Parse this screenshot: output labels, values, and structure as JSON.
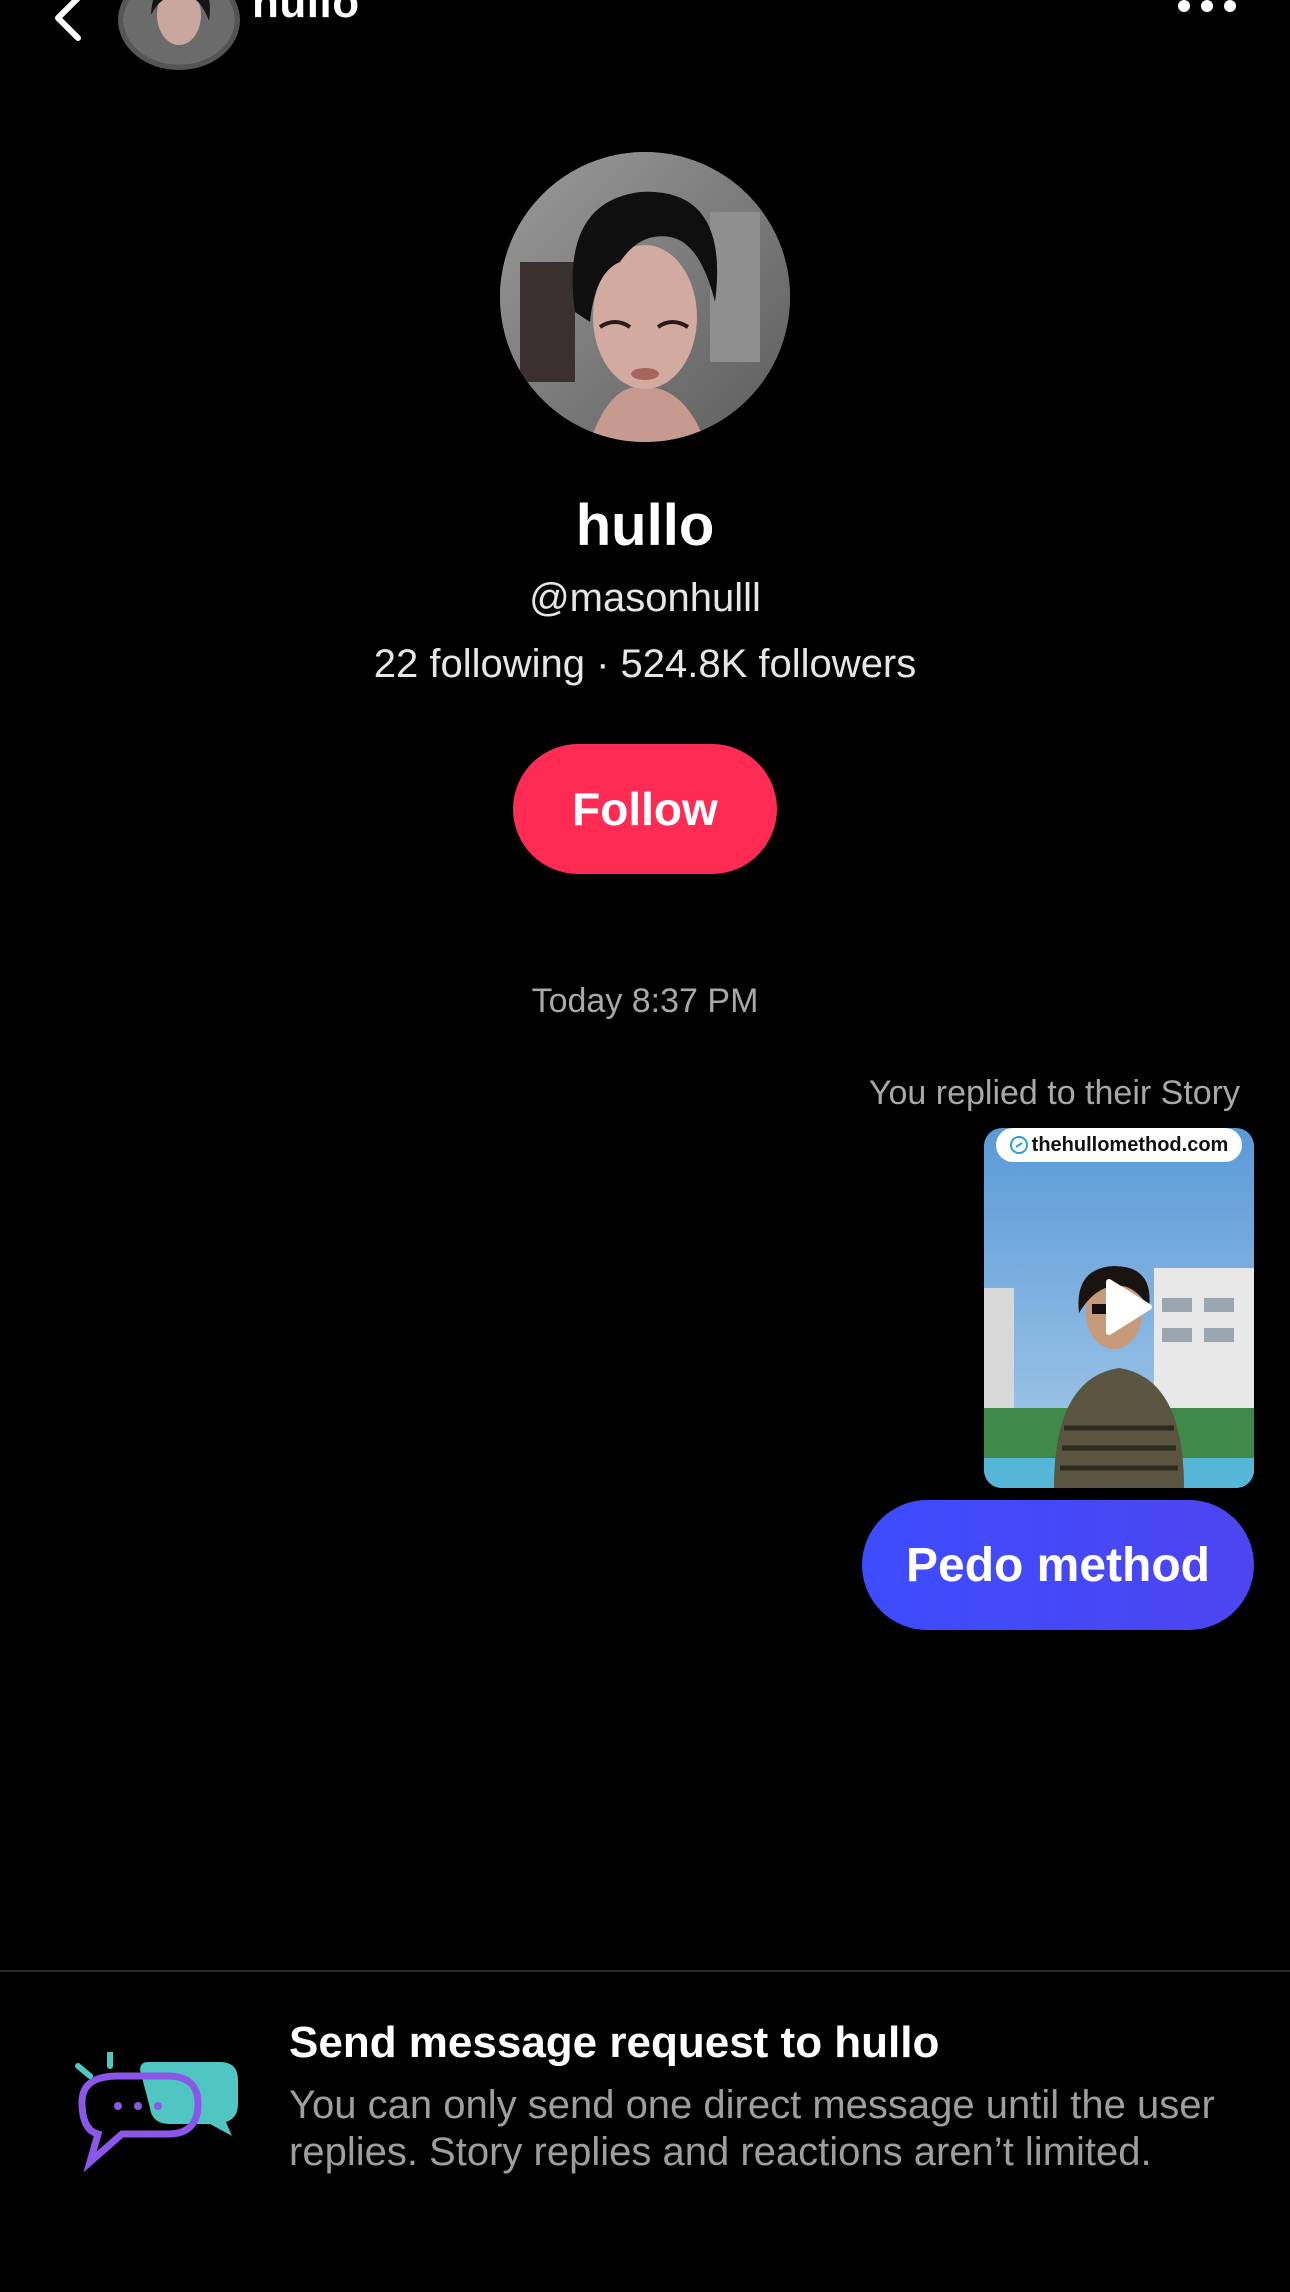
{
  "header": {
    "title": "hullo"
  },
  "profile": {
    "name": "hullo",
    "handle": "@masonhulll",
    "stats": "22 following · 524.8K followers",
    "follow_label": "Follow"
  },
  "conversation": {
    "timestamp": "Today 8:37 PM",
    "story_reply_note": "You replied to their Story",
    "story_link": "thehullomethod.com",
    "sent_message": "Pedo method"
  },
  "request_panel": {
    "title": "Send message request to hullo",
    "body": "You can only send one direct message until the user replies. Story replies and reactions aren’t limited."
  },
  "colors": {
    "background": "#000000",
    "follow_button": "#fe2c55",
    "message_bubble": "#3d4cff",
    "secondary_text": "#a8a8a8"
  }
}
